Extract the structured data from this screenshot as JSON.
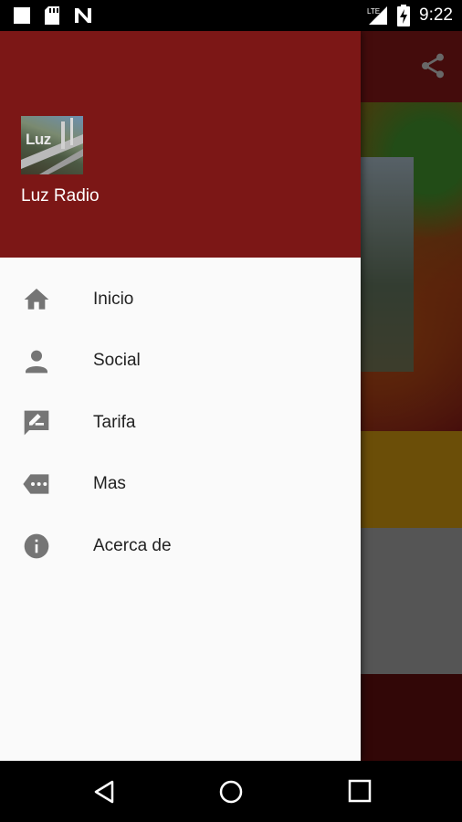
{
  "status_bar": {
    "time": "9:22",
    "network": "LTE",
    "left_icons": [
      "stop-icon",
      "sd-card-icon",
      "n-icon"
    ],
    "right_icons": [
      "signal-icon",
      "battery-charging-icon"
    ]
  },
  "app": {
    "title": "Luz Radio",
    "logo_text": "Luz"
  },
  "drawer": {
    "items": [
      {
        "label": "Inicio",
        "icon": "home-icon"
      },
      {
        "label": "Social",
        "icon": "person-icon"
      },
      {
        "label": "Tarifa",
        "icon": "rate-review-icon"
      },
      {
        "label": "Mas",
        "icon": "more-icon"
      },
      {
        "label": "Acerca de",
        "icon": "info-icon"
      }
    ]
  },
  "toolbar": {
    "share_icon": "share-icon"
  },
  "navigation_bar": {
    "buttons": [
      "back-icon",
      "home-circle-icon",
      "recents-icon"
    ]
  },
  "colors": {
    "primary": "#7c1716",
    "drawer_background": "#fafafa",
    "icon_gray": "#757575"
  }
}
